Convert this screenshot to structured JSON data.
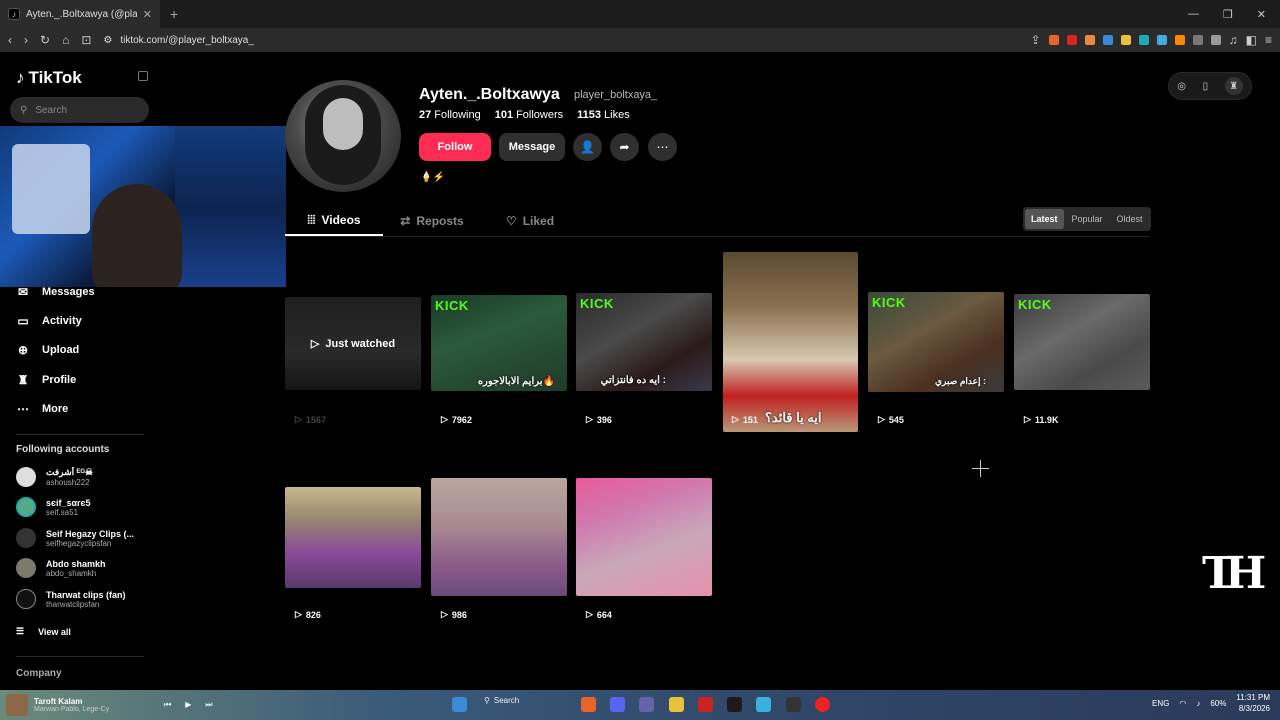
{
  "browser": {
    "tab_title": "Ayten._.Boltxawya (@player_bolt",
    "tab_close": "✕",
    "new_tab": "+",
    "url": "tiktok.com/@player_boltxaya_",
    "win_min": "—",
    "win_max": "❐",
    "win_close": "✕"
  },
  "sidebar": {
    "logo": "TikTok",
    "search_placeholder": "Search",
    "menu": [
      {
        "label": "Messages",
        "icon": "✉"
      },
      {
        "label": "Activity",
        "icon": "▭"
      },
      {
        "label": "Upload",
        "icon": "⊕"
      },
      {
        "label": "Profile",
        "icon": "♜"
      },
      {
        "label": "More",
        "icon": "⋯"
      }
    ],
    "following_title": "Following accounts",
    "accounts": [
      {
        "name": "أشرفت ᴱᴳ☠",
        "username": "ashoush222"
      },
      {
        "name": "sєif_sαrє5",
        "username": "seif.sa51"
      },
      {
        "name": "Seif Hegazy Clips (...",
        "username": "seifhegazyclipsfan"
      },
      {
        "name": "Abdo shamkh",
        "username": "abdo_shamkh"
      },
      {
        "name": "Tharwat clips (fan)",
        "username": "tharwatclipsfan"
      }
    ],
    "view_all": "View all",
    "company": "Company"
  },
  "profile": {
    "display_name": "Ayten._.Boltxawya",
    "username": "player_boltxaya_",
    "following_count": "27",
    "following_label": "Following",
    "followers_count": "101",
    "followers_label": "Followers",
    "likes_count": "1153",
    "likes_label": "Likes",
    "follow_label": "Follow",
    "message_label": "Message",
    "bio": "🍦⚡"
  },
  "tabs": {
    "videos": "Videos",
    "reposts": "Reposts",
    "liked": "Liked"
  },
  "sort": {
    "latest": "Latest",
    "popular": "Popular",
    "oldest": "Oldest"
  },
  "videos": [
    {
      "views": "1567",
      "overlay": "Just watched",
      "caption": ""
    },
    {
      "views": "7962",
      "kick": "KICK",
      "caption": "برايم الابالاجوره🔥"
    },
    {
      "views": "396",
      "kick": "KICK",
      "caption": "ايه ده فانتزاتي :"
    },
    {
      "views": "151",
      "caption": "ايه يا قائد؟"
    },
    {
      "views": "545",
      "kick": "KICK",
      "caption": "إعدام صبري :"
    },
    {
      "views": "11.9K",
      "kick": "KICK",
      "caption": ""
    },
    {
      "views": "826",
      "caption": ""
    },
    {
      "views": "986",
      "caption": ""
    },
    {
      "views": "664",
      "caption": ""
    }
  ],
  "taskbar": {
    "media_title": "Taroft Kalam",
    "media_sub": "Marwan Pablo, Lege-Cy",
    "search": "Search",
    "lang": "ENG",
    "battery": "60%",
    "time": "11:31 PM",
    "date": "8/3/2026"
  },
  "colors": {
    "follow": "#fe2c55",
    "kick_green": "#53fc18",
    "background": "#000000"
  }
}
